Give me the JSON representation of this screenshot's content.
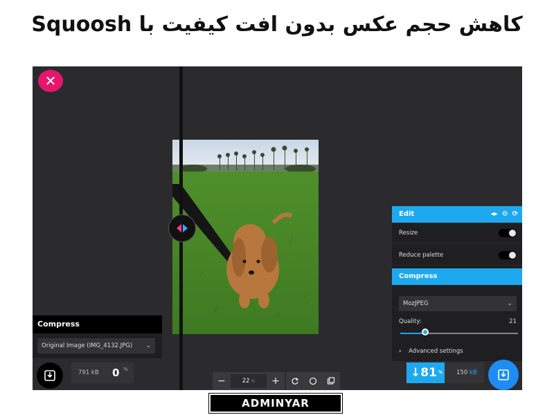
{
  "banner": {
    "title": "کاهش حجم عکس بدون افت کیفیت با Squoosh"
  },
  "app": {
    "close_icon": "close-icon",
    "left_panel": {
      "header": "Compress",
      "select_value": "Original Image (IMG_4132.JPG)",
      "file_size": "791 kB",
      "reduction": "0",
      "reduction_unit": "%"
    },
    "toolbar": {
      "zoom_out": "−",
      "zoom_value": "22",
      "zoom_unit": "%",
      "zoom_in": "+"
    },
    "right_panel": {
      "edit_header": "Edit",
      "resize_label": "Resize",
      "reduce_palette_label": "Reduce palette",
      "compress_header": "Compress",
      "codec_value": "MozJPEG",
      "quality_label": "Quality:",
      "quality_value": "21",
      "quality_fraction": 0.21,
      "advanced_label": "Advanced settings",
      "result_arrow": "↓",
      "result_pct": "81",
      "result_pct_unit": "%",
      "result_size": "150",
      "result_size_unit": "kB"
    },
    "colors": {
      "accent": "#1ea8ef",
      "close": "#e6166f",
      "background": "#2b2b2d"
    }
  },
  "footer": {
    "badge": "ADMINYAR"
  }
}
